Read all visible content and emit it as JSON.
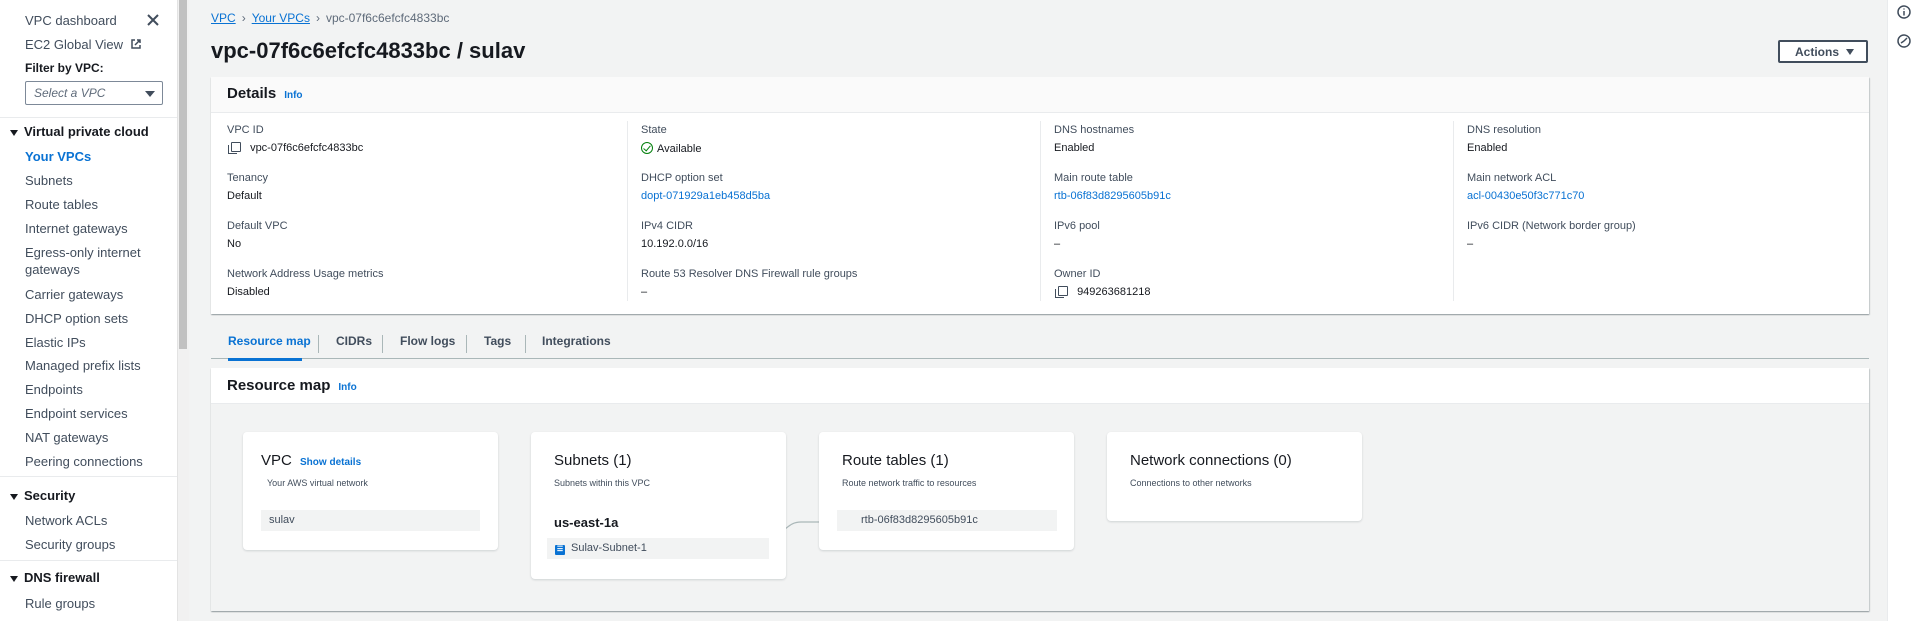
{
  "sidebar": {
    "links": [
      "VPC dashboard",
      "EC2 Global View"
    ],
    "filter_label": "Filter by VPC:",
    "filter_placeholder": "Select a VPC",
    "sections": [
      {
        "title": "Virtual private cloud",
        "items": [
          "Your VPCs",
          "Subnets",
          "Route tables",
          "Internet gateways",
          "Egress-only internet",
          "gateways",
          "Carrier gateways",
          "DHCP option sets",
          "Elastic IPs",
          "Managed prefix lists",
          "Endpoints",
          "Endpoint services",
          "NAT gateways",
          "Peering connections"
        ]
      },
      {
        "title": "Security",
        "items": [
          "Network ACLs",
          "Security groups"
        ]
      },
      {
        "title": "DNS firewall",
        "items": [
          "Rule groups"
        ]
      }
    ]
  },
  "breadcrumb": {
    "root": "VPC",
    "parent": "Your VPCs",
    "current": "vpc-07f6c6efcfc4833bc"
  },
  "page_title": "vpc-07f6c6efcfc4833bc / sulav",
  "actions_label": "Actions",
  "info_label": "Info",
  "details": {
    "title": "Details",
    "vpc_id": {
      "label": "VPC ID",
      "value": "vpc-07f6c6efcfc4833bc"
    },
    "tenancy": {
      "label": "Tenancy",
      "value": "Default"
    },
    "default_vpc": {
      "label": "Default VPC",
      "value": "No"
    },
    "nau_metrics": {
      "label": "Network Address Usage metrics",
      "value": "Disabled"
    },
    "state": {
      "label": "State",
      "value": "Available"
    },
    "dhcp": {
      "label": "DHCP option set",
      "value": "dopt-071929a1eb458d5ba"
    },
    "ipv4": {
      "label": "IPv4 CIDR",
      "value": "10.192.0.0/16"
    },
    "r53": {
      "label": "Route 53 Resolver DNS Firewall rule groups",
      "value": "–"
    },
    "dns_hostnames": {
      "label": "DNS hostnames",
      "value": "Enabled"
    },
    "main_rt": {
      "label": "Main route table",
      "value": "rtb-06f83d8295605b91c"
    },
    "ipv6_pool": {
      "label": "IPv6 pool",
      "value": "–"
    },
    "owner": {
      "label": "Owner ID",
      "value": "949263681218"
    },
    "dns_resolution": {
      "label": "DNS resolution",
      "value": "Enabled"
    },
    "main_acl": {
      "label": "Main network ACL",
      "value": "acl-00430e50f3c771c70"
    },
    "ipv6_cidr": {
      "label": "IPv6 CIDR (Network border group)",
      "value": "–"
    }
  },
  "tabs": [
    "Resource map",
    "CIDRs",
    "Flow logs",
    "Tags",
    "Integrations"
  ],
  "resource_map": {
    "title": "Resource map",
    "vpc": {
      "title": "VPC",
      "link": "Show details",
      "subtitle": "Your AWS virtual network",
      "chip": "sulav"
    },
    "subnets": {
      "title": "Subnets (1)",
      "subtitle": "Subnets within this VPC",
      "az": "us-east-1a",
      "chip": "Sulav-Subnet-1"
    },
    "route_tables": {
      "title": "Route tables (1)",
      "subtitle": "Route network traffic to resources",
      "chip": "rtb-06f83d8295605b91c"
    },
    "network": {
      "title": "Network connections (0)",
      "subtitle": "Connections to other networks"
    }
  },
  "colors": {
    "link": "#0972d3",
    "success": "#037f0c",
    "text": "#16191f",
    "muted": "#414d5c"
  }
}
